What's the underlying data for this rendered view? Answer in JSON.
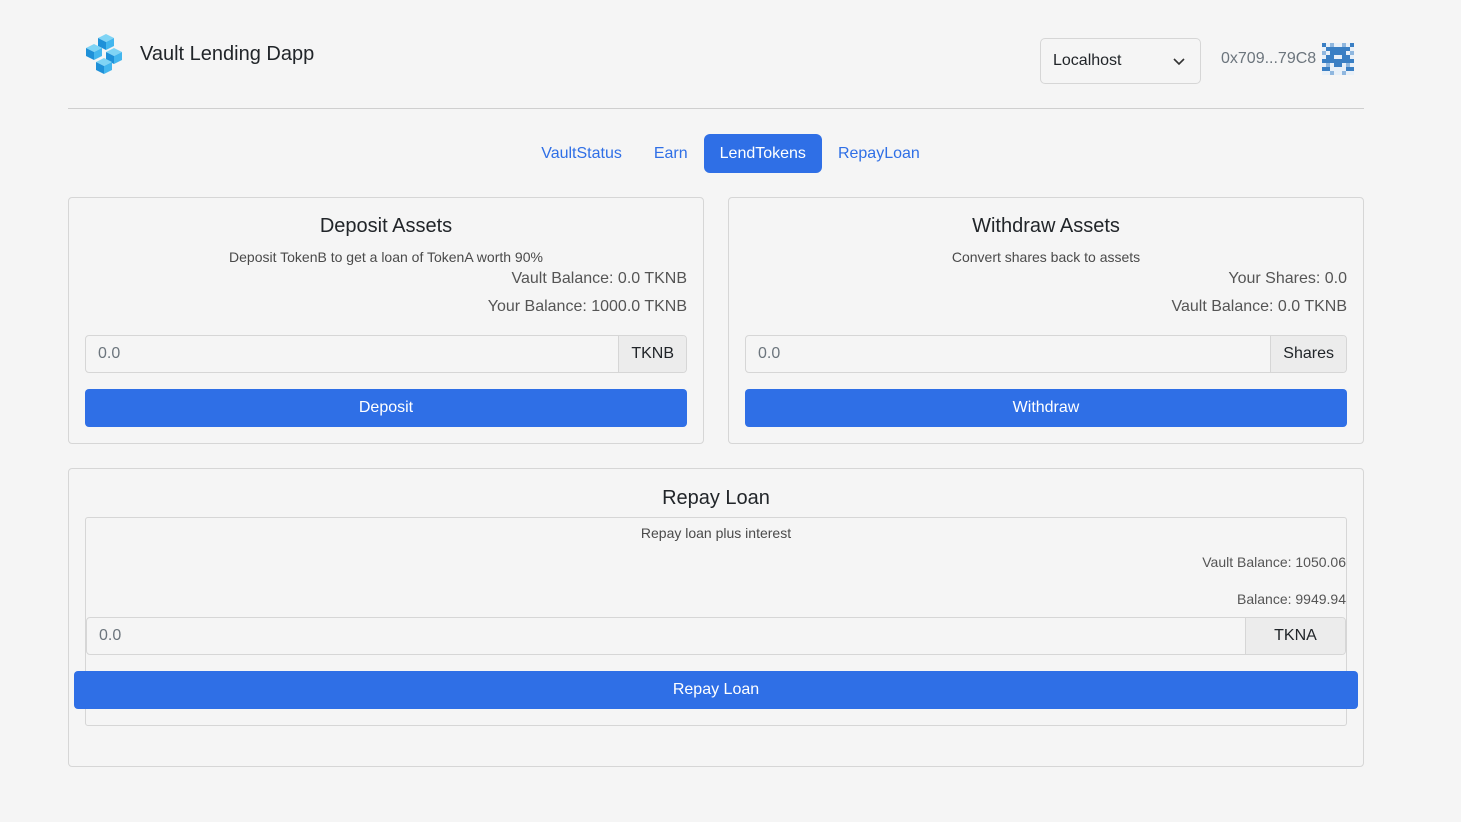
{
  "header": {
    "app_name": "Vault Lending Dapp",
    "network": "Localhost",
    "account_address": "0x709...79C8",
    "logo_icon": "cube-logo-icon",
    "brand_color": "#2f6fe6"
  },
  "tabs": [
    {
      "label": "VaultStatus",
      "active": false
    },
    {
      "label": "Earn",
      "active": false
    },
    {
      "label": "LendTokens",
      "active": true
    },
    {
      "label": "RepayLoan",
      "active": false
    }
  ],
  "deposit": {
    "title": "Deposit Assets",
    "subtitle": "Deposit TokenB to get a loan of TokenA worth 90%",
    "vault_balance": "Vault Balance: 0.0 TKNB",
    "your_balance": "Your Balance: 1000.0 TKNB",
    "input_placeholder": "0.0",
    "unit": "TKNB",
    "button_label": "Deposit"
  },
  "withdraw": {
    "title": "Withdraw Assets",
    "subtitle": "Convert shares back to assets",
    "your_shares": "Your Shares: 0.0",
    "vault_balance": "Vault Balance: 0.0 TKNB",
    "input_placeholder": "0.0",
    "unit": "Shares",
    "button_label": "Withdraw"
  },
  "repay": {
    "title": "Repay Loan",
    "subtitle": "Repay loan plus interest",
    "vault_balance": "Vault Balance: 1050.06",
    "balance": "Balance: 9949.94",
    "input_placeholder": "0.0",
    "unit": "TKNA",
    "button_label": "Repay Loan"
  }
}
